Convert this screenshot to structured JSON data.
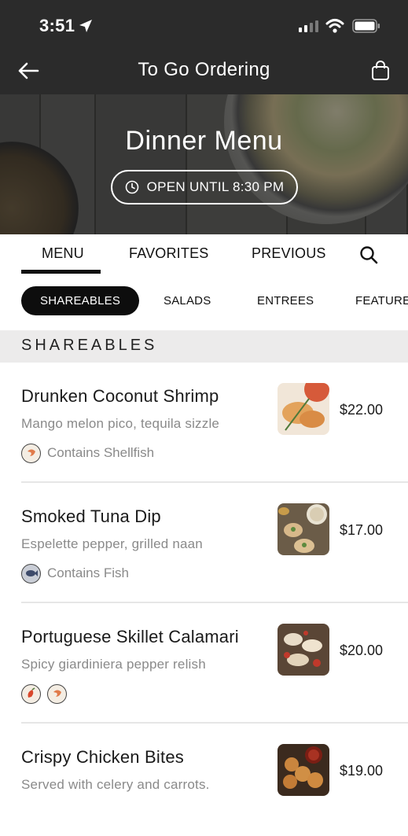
{
  "status_bar": {
    "time": "3:51"
  },
  "header": {
    "title": "To Go Ordering"
  },
  "hero": {
    "title": "Dinner Menu",
    "hours": "OPEN UNTIL 8:30 PM"
  },
  "tabs": [
    {
      "label": "MENU",
      "active": true
    },
    {
      "label": "FAVORITES"
    },
    {
      "label": "PREVIOUS"
    }
  ],
  "categories": [
    {
      "label": "SHAREABLES",
      "active": true
    },
    {
      "label": "SALADS"
    },
    {
      "label": "ENTREES"
    },
    {
      "label": "FEATURE"
    }
  ],
  "section": {
    "title": "SHAREABLES"
  },
  "items": [
    {
      "name": "Drunken Coconut Shrimp",
      "description": "Mango melon pico, tequila sizzle",
      "allergen_label": "Contains Shellfish",
      "price": "$22.00"
    },
    {
      "name": "Smoked Tuna Dip",
      "description": "Espelette pepper, grilled naan",
      "allergen_label": "Contains Fish",
      "price": "$17.00"
    },
    {
      "name": "Portuguese Skillet Calamari",
      "description": "Spicy giardiniera pepper relish",
      "price": "$20.00"
    },
    {
      "name": "Crispy Chicken Bites",
      "description": "Served with celery and carrots.",
      "price": "$19.00"
    }
  ],
  "icons": {
    "back": "arrow-left-icon",
    "cart": "shopping-bag-icon",
    "clock": "clock-icon",
    "search": "search-icon",
    "shellfish": "shrimp-icon",
    "fish": "fish-icon",
    "spicy": "pepper-icon"
  },
  "colors": {
    "header_bg": "#2b2b2b",
    "active_chip": "#0d0d0d",
    "section_bg": "#ecebeb",
    "muted_text": "#8a8a8a"
  }
}
